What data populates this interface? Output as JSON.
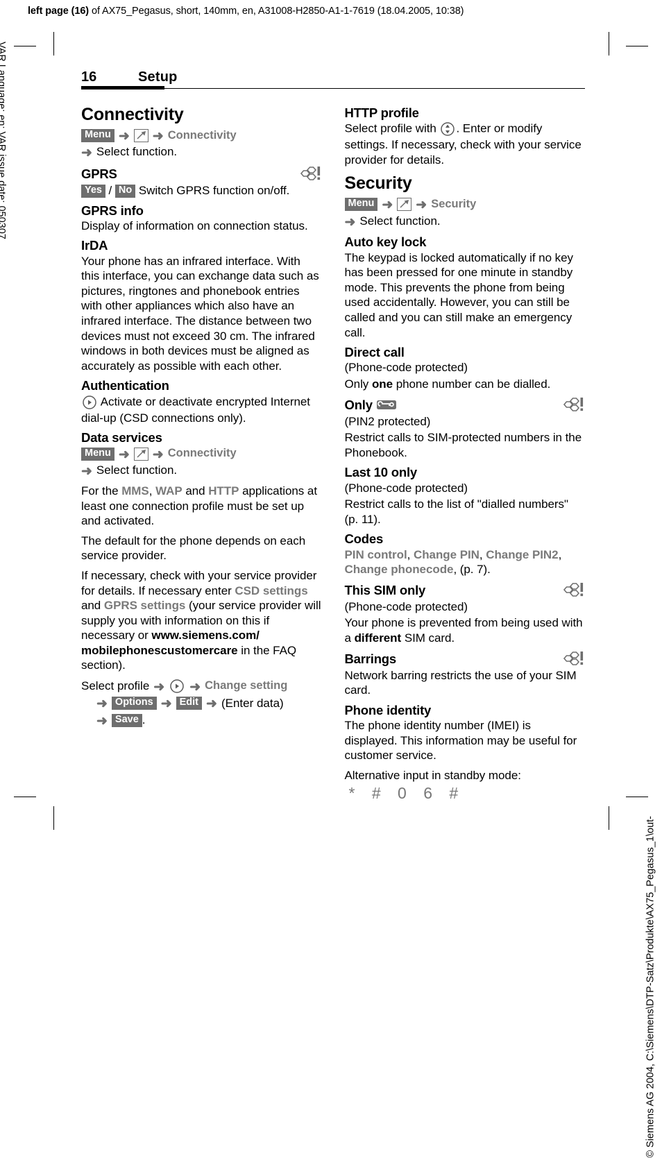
{
  "print_header": {
    "bold_prefix": "left page (16)",
    "rest": " of AX75_Pegasus, short, 140mm, en, A31008-H2850-A1-1-7619 (18.04.2005, 10:38)"
  },
  "margin_notes": {
    "left": "VAR Language: en; VAR issue date: 050307",
    "right": "© Siemens AG 2004, C:\\Siemens\\DTP-Satz\\Produkte\\AX75_Pegasus_1\\out-"
  },
  "page_header": {
    "number": "16",
    "title": "Setup"
  },
  "icons": {
    "setup": "setup-wrench-icon",
    "network_dependent": "network-dependent-icon",
    "nav_right": "nav-key-right-icon",
    "nav_updown": "nav-key-up-down-icon",
    "sim_lock": "sim-lock-icon"
  },
  "left_column": {
    "section_title": "Connectivity",
    "menu_path": {
      "softkey": "Menu",
      "target": "Connectivity",
      "select": "Select function."
    },
    "gprs": {
      "heading": "GPRS",
      "yes": "Yes",
      "sep": "/",
      "no": "No",
      "text": "Switch GPRS function on/off."
    },
    "gprs_info": {
      "heading": "GPRS info",
      "text": "Display of information on connection status."
    },
    "irda": {
      "heading": "IrDA",
      "text": "Your phone has an infrared interface. With this interface, you can exchange data such as pictures, ringtones and phonebook entries with other appliances which also have an infrared interface. The distance between two devices must not exceed 30 cm. The infrared windows in both devices must be aligned as accurately as possible with each other."
    },
    "authentication": {
      "heading": "Authentication",
      "text": "Activate or deactivate encrypted Internet dial-up (CSD connections only)."
    },
    "data_services": {
      "heading": "Data services",
      "menu_path": {
        "softkey": "Menu",
        "target": "Connectivity",
        "select": "Select function."
      },
      "para1_pre": "For the ",
      "para1_mms": "MMS",
      "para1_c1": ", ",
      "para1_wap": "WAP",
      "para1_and": " and ",
      "para1_http": "HTTP",
      "para1_post": " applications at least one connection profile must be set up and activated.",
      "para2": "The default for the phone depends on each service provider.",
      "para3_pre": "If necessary, check with your service provider for details. If necessary enter ",
      "para3_csd": "CSD settings",
      "para3_and": " and ",
      "para3_gprs": "GPRS settings",
      "para3_mid": " (your service provider will supply you with information on this if necessary or ",
      "para3_url": "www.siemens.com/ mobilephonescustomercare",
      "para3_post": " in the FAQ section).",
      "steps": {
        "select_profile": "Select profile",
        "change_setting": "Change setting",
        "options": "Options",
        "edit": "Edit",
        "enter_data": "(Enter data)",
        "save": "Save",
        "period": "."
      }
    }
  },
  "right_column": {
    "http_profile": {
      "heading": "HTTP profile",
      "text_pre": "Select profile with ",
      "text_post": ". Enter or modify settings. If necessary, check with your service provider for details."
    },
    "security": {
      "section_title": "Security",
      "menu_path": {
        "softkey": "Menu",
        "target": "Security",
        "select": "Select function."
      },
      "auto_key_lock": {
        "heading": "Auto key lock",
        "text": "The keypad is locked automatically if no key has been pressed for one minute in standby mode. This prevents the phone from being used accidentally. However, you can still be called and you can still make an emergency call."
      },
      "direct_call": {
        "heading": "Direct call",
        "protected": "(Phone-code protected)",
        "text_pre": "Only ",
        "text_bold": "one",
        "text_post": " phone number can be dialled."
      },
      "only": {
        "heading": "Only",
        "protected": "(PIN2 protected)",
        "text": "Restrict calls to SIM-protected numbers in the Phonebook."
      },
      "last10": {
        "heading": "Last 10 only",
        "protected": "(Phone-code protected)",
        "text": "Restrict calls to the list of \"dialled numbers\" (p. 11)."
      },
      "codes": {
        "heading": "Codes",
        "item1": "PIN control",
        "item2": "Change PIN",
        "item3": "Change PIN2",
        "item4": "Change phonecode",
        "page_ref": ", (p. 7)."
      },
      "this_sim_only": {
        "heading": "This SIM only",
        "protected": "(Phone-code protected)",
        "text_pre": "Your phone is prevented from being used with a ",
        "text_bold": "different",
        "text_post": " SIM card."
      },
      "barrings": {
        "heading": "Barrings",
        "text": "Network barring restricts the use of your SIM card."
      },
      "phone_identity": {
        "heading": "Phone identity",
        "text": "The phone identity number (IMEI) is displayed. This information may be useful for customer service.",
        "alt_label": "Alternative input in standby mode:",
        "key_sequence": "* # 0 6 #"
      }
    }
  },
  "colors": {
    "softkey_bg": "#6e6e6e",
    "grey_term": "#7a7a7a",
    "icon_grey": "#6e6e6e"
  }
}
